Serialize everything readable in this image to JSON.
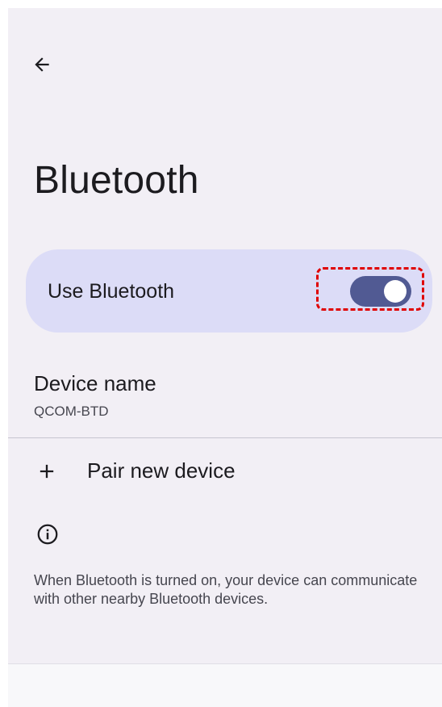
{
  "header": {
    "back_icon": "arrow-back-icon",
    "title": "Bluetooth"
  },
  "main_switch": {
    "label": "Use Bluetooth",
    "checked": true,
    "track_color": "#515a93",
    "card_color": "#dcdcf7",
    "highlight_color": "#e00000"
  },
  "device_name": {
    "title": "Device name",
    "summary": "QCOM-BTD"
  },
  "pair_new_device": {
    "icon": "plus-icon",
    "label": "Pair new device"
  },
  "footer": {
    "icon": "info-icon",
    "text": "When Bluetooth is turned on, your device can communicate with other nearby Bluetooth devices."
  }
}
